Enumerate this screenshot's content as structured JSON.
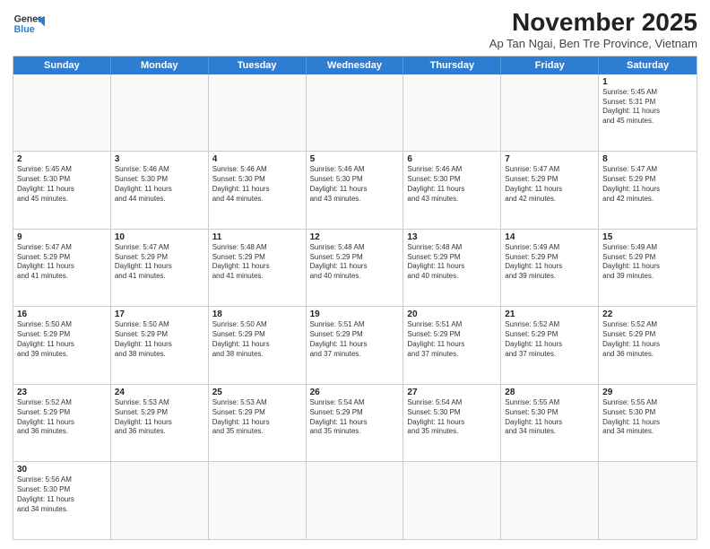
{
  "header": {
    "logo_line1": "General",
    "logo_line2": "Blue",
    "month_title": "November 2025",
    "location": "Ap Tan Ngai, Ben Tre Province, Vietnam"
  },
  "weekdays": [
    "Sunday",
    "Monday",
    "Tuesday",
    "Wednesday",
    "Thursday",
    "Friday",
    "Saturday"
  ],
  "rows": [
    [
      {
        "day": "",
        "info": ""
      },
      {
        "day": "",
        "info": ""
      },
      {
        "day": "",
        "info": ""
      },
      {
        "day": "",
        "info": ""
      },
      {
        "day": "",
        "info": ""
      },
      {
        "day": "",
        "info": ""
      },
      {
        "day": "1",
        "info": "Sunrise: 5:45 AM\nSunset: 5:31 PM\nDaylight: 11 hours\nand 45 minutes."
      }
    ],
    [
      {
        "day": "2",
        "info": "Sunrise: 5:45 AM\nSunset: 5:30 PM\nDaylight: 11 hours\nand 45 minutes."
      },
      {
        "day": "3",
        "info": "Sunrise: 5:46 AM\nSunset: 5:30 PM\nDaylight: 11 hours\nand 44 minutes."
      },
      {
        "day": "4",
        "info": "Sunrise: 5:46 AM\nSunset: 5:30 PM\nDaylight: 11 hours\nand 44 minutes."
      },
      {
        "day": "5",
        "info": "Sunrise: 5:46 AM\nSunset: 5:30 PM\nDaylight: 11 hours\nand 43 minutes."
      },
      {
        "day": "6",
        "info": "Sunrise: 5:46 AM\nSunset: 5:30 PM\nDaylight: 11 hours\nand 43 minutes."
      },
      {
        "day": "7",
        "info": "Sunrise: 5:47 AM\nSunset: 5:29 PM\nDaylight: 11 hours\nand 42 minutes."
      },
      {
        "day": "8",
        "info": "Sunrise: 5:47 AM\nSunset: 5:29 PM\nDaylight: 11 hours\nand 42 minutes."
      }
    ],
    [
      {
        "day": "9",
        "info": "Sunrise: 5:47 AM\nSunset: 5:29 PM\nDaylight: 11 hours\nand 41 minutes."
      },
      {
        "day": "10",
        "info": "Sunrise: 5:47 AM\nSunset: 5:29 PM\nDaylight: 11 hours\nand 41 minutes."
      },
      {
        "day": "11",
        "info": "Sunrise: 5:48 AM\nSunset: 5:29 PM\nDaylight: 11 hours\nand 41 minutes."
      },
      {
        "day": "12",
        "info": "Sunrise: 5:48 AM\nSunset: 5:29 PM\nDaylight: 11 hours\nand 40 minutes."
      },
      {
        "day": "13",
        "info": "Sunrise: 5:48 AM\nSunset: 5:29 PM\nDaylight: 11 hours\nand 40 minutes."
      },
      {
        "day": "14",
        "info": "Sunrise: 5:49 AM\nSunset: 5:29 PM\nDaylight: 11 hours\nand 39 minutes."
      },
      {
        "day": "15",
        "info": "Sunrise: 5:49 AM\nSunset: 5:29 PM\nDaylight: 11 hours\nand 39 minutes."
      }
    ],
    [
      {
        "day": "16",
        "info": "Sunrise: 5:50 AM\nSunset: 5:29 PM\nDaylight: 11 hours\nand 39 minutes."
      },
      {
        "day": "17",
        "info": "Sunrise: 5:50 AM\nSunset: 5:29 PM\nDaylight: 11 hours\nand 38 minutes."
      },
      {
        "day": "18",
        "info": "Sunrise: 5:50 AM\nSunset: 5:29 PM\nDaylight: 11 hours\nand 38 minutes."
      },
      {
        "day": "19",
        "info": "Sunrise: 5:51 AM\nSunset: 5:29 PM\nDaylight: 11 hours\nand 37 minutes."
      },
      {
        "day": "20",
        "info": "Sunrise: 5:51 AM\nSunset: 5:29 PM\nDaylight: 11 hours\nand 37 minutes."
      },
      {
        "day": "21",
        "info": "Sunrise: 5:52 AM\nSunset: 5:29 PM\nDaylight: 11 hours\nand 37 minutes."
      },
      {
        "day": "22",
        "info": "Sunrise: 5:52 AM\nSunset: 5:29 PM\nDaylight: 11 hours\nand 36 minutes."
      }
    ],
    [
      {
        "day": "23",
        "info": "Sunrise: 5:52 AM\nSunset: 5:29 PM\nDaylight: 11 hours\nand 36 minutes."
      },
      {
        "day": "24",
        "info": "Sunrise: 5:53 AM\nSunset: 5:29 PM\nDaylight: 11 hours\nand 36 minutes."
      },
      {
        "day": "25",
        "info": "Sunrise: 5:53 AM\nSunset: 5:29 PM\nDaylight: 11 hours\nand 35 minutes."
      },
      {
        "day": "26",
        "info": "Sunrise: 5:54 AM\nSunset: 5:29 PM\nDaylight: 11 hours\nand 35 minutes."
      },
      {
        "day": "27",
        "info": "Sunrise: 5:54 AM\nSunset: 5:30 PM\nDaylight: 11 hours\nand 35 minutes."
      },
      {
        "day": "28",
        "info": "Sunrise: 5:55 AM\nSunset: 5:30 PM\nDaylight: 11 hours\nand 34 minutes."
      },
      {
        "day": "29",
        "info": "Sunrise: 5:55 AM\nSunset: 5:30 PM\nDaylight: 11 hours\nand 34 minutes."
      }
    ],
    [
      {
        "day": "30",
        "info": "Sunrise: 5:56 AM\nSunset: 5:30 PM\nDaylight: 11 hours\nand 34 minutes."
      },
      {
        "day": "",
        "info": ""
      },
      {
        "day": "",
        "info": ""
      },
      {
        "day": "",
        "info": ""
      },
      {
        "day": "",
        "info": ""
      },
      {
        "day": "",
        "info": ""
      },
      {
        "day": "",
        "info": ""
      }
    ]
  ]
}
